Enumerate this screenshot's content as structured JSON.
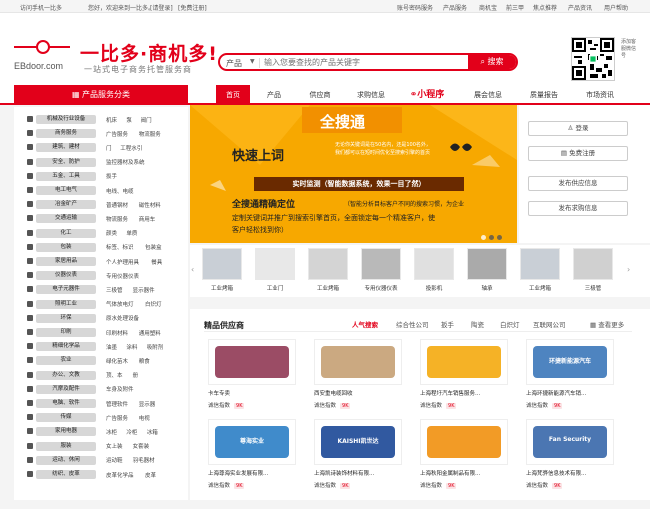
{
  "topbar": {
    "mobile": "访问手机一比多",
    "greeting": "您好，欢迎来到一比多。",
    "login": "[请登录]",
    "register": "[免费注册]",
    "links": [
      "账号密码服务",
      "产品服务",
      "商机宝",
      "前三甲",
      "焦点推荐",
      "产品资讯",
      "用户帮助"
    ]
  },
  "header": {
    "logo_sub": "EBdoor.com",
    "brand": "一比多·商机多!",
    "slogan": "一站式电子商务托管服务商",
    "search_category": "产品",
    "search_placeholder": "输入您要查找的产品关键字",
    "search_button": "搜索",
    "qr_text": "添加客服微信号"
  },
  "nav": {
    "category_title": "产品服务分类",
    "items": [
      "首页",
      "产品",
      "供应商",
      "求购信息",
      "小程序",
      "展会信息",
      "质量报告",
      "市场资讯"
    ]
  },
  "categories": [
    {
      "name": "机械及行业设备",
      "subs": [
        "机床",
        "泵",
        "阀门"
      ]
    },
    {
      "name": "商务服务",
      "subs": [
        "广告服务",
        "物流服务"
      ]
    },
    {
      "name": "建筑、建材",
      "subs": [
        "门",
        "工程水引"
      ]
    },
    {
      "name": "安全、防护",
      "subs": [
        "监控器材及系统"
      ]
    },
    {
      "name": "五金、工具",
      "subs": [
        "扳手"
      ]
    },
    {
      "name": "电工电气",
      "subs": [
        "电线、电缆"
      ]
    },
    {
      "name": "冶金矿产",
      "subs": [
        "普通钢材",
        "磁性材料"
      ]
    },
    {
      "name": "交通运输",
      "subs": [
        "物流服务",
        "商用车"
      ]
    },
    {
      "name": "化工",
      "subs": [
        "颜类",
        "单质"
      ]
    },
    {
      "name": "包装",
      "subs": [
        "标签、标识",
        "包装盒"
      ]
    },
    {
      "name": "家居用品",
      "subs": [
        "个人护理用具",
        "餐具"
      ]
    },
    {
      "name": "仪器仪表",
      "subs": [
        "专用仪器仪表"
      ]
    },
    {
      "name": "电子元器件",
      "subs": [
        "三极管",
        "显示器件"
      ]
    },
    {
      "name": "照明工业",
      "subs": [
        "气体放电灯",
        "白炽灯"
      ]
    },
    {
      "name": "环保",
      "subs": [
        "原水处理设备"
      ]
    },
    {
      "name": "印刷",
      "subs": [
        "印刷材料",
        "通用塑料"
      ]
    },
    {
      "name": "精细化学品",
      "subs": [
        "油墨",
        "涂料",
        "吸附剂"
      ]
    },
    {
      "name": "农业",
      "subs": [
        "绿化苗木",
        "粮食"
      ]
    },
    {
      "name": "办公、文教",
      "subs": [
        "顶、本",
        "册"
      ]
    },
    {
      "name": "汽摩及配件",
      "subs": [
        "车身及附件"
      ]
    },
    {
      "name": "电脑、软件",
      "subs": [
        "管理软件",
        "显示器"
      ]
    },
    {
      "name": "传媒",
      "subs": [
        "广告服务",
        "电视"
      ]
    },
    {
      "name": "家用电器",
      "subs": [
        "冰柜",
        "冷柜",
        "冰箱"
      ]
    },
    {
      "name": "服装",
      "subs": [
        "女上装",
        "女套装"
      ]
    },
    {
      "name": "运动、休闲",
      "subs": [
        "运动鞋",
        "羽毛器材"
      ]
    },
    {
      "name": "纺织、皮革",
      "subs": [
        "皮革化学品",
        "皮革"
      ]
    }
  ],
  "banner": {
    "title": "全搜通",
    "sub1": "无论你关键词是在50名内，还是100名外，",
    "sub2": "我们都可以在短时间优化至搜索引擎的首页",
    "fast": "快速上词",
    "bar": "实时监测（智能数据系统，效果一目了然）",
    "head": "全搜通精确定位",
    "note": "（智能分析目标客户不同的搜索习惯，为企业",
    "line2": "定制关键词并推广到搜索引擎首页，全面锁定每一个精准客户，使",
    "line3": "客户轻松找到你）"
  },
  "right_panel": {
    "buttons": [
      "登录",
      "免费注册",
      "发布供应信息",
      "发布求购信息"
    ]
  },
  "products": [
    {
      "name": "工业烤箱"
    },
    {
      "name": "工业门"
    },
    {
      "name": "工业烤箱"
    },
    {
      "name": "专用仪器仪表"
    },
    {
      "name": "投影机"
    },
    {
      "name": "轴承"
    },
    {
      "name": "工业烤箱"
    },
    {
      "name": "三极管"
    }
  ],
  "suppliers": {
    "title": "精品供应商",
    "tabs": [
      "人气搜索",
      "综合性公司",
      "扳手",
      "陶瓷",
      "白炽灯",
      "互联网公司"
    ],
    "more": "查看更多",
    "cards": [
      {
        "name": "卡车专卖",
        "tag": "诚信指数",
        "score": "9K"
      },
      {
        "name": "西安重电缆回收",
        "tag": "诚信指数",
        "score": "9K"
      },
      {
        "name": "上海程圩汽车销售服务...",
        "tag": "诚信指数",
        "score": "9K"
      },
      {
        "name": "上海环捷新能源汽车销...",
        "tag": "诚信指数",
        "score": "9K"
      },
      {
        "name": "上海尊海实业发展有限...",
        "tag": "诚信指数",
        "score": "9K"
      },
      {
        "name": "上海凯诗装饰材料有限...",
        "tag": "诚信指数",
        "score": "9K"
      },
      {
        "name": "上海秋阳金属制品有限...",
        "tag": "诚信指数",
        "score": "9K"
      },
      {
        "name": "上海梵骅信息技术有限...",
        "tag": "诚信指数",
        "score": "9K"
      }
    ],
    "logo_texts": {
      "c4": "环捷新能源汽车",
      "c5": "尊海实业",
      "c6": "KAISHI凯世达",
      "c8": "Fan Security"
    }
  }
}
